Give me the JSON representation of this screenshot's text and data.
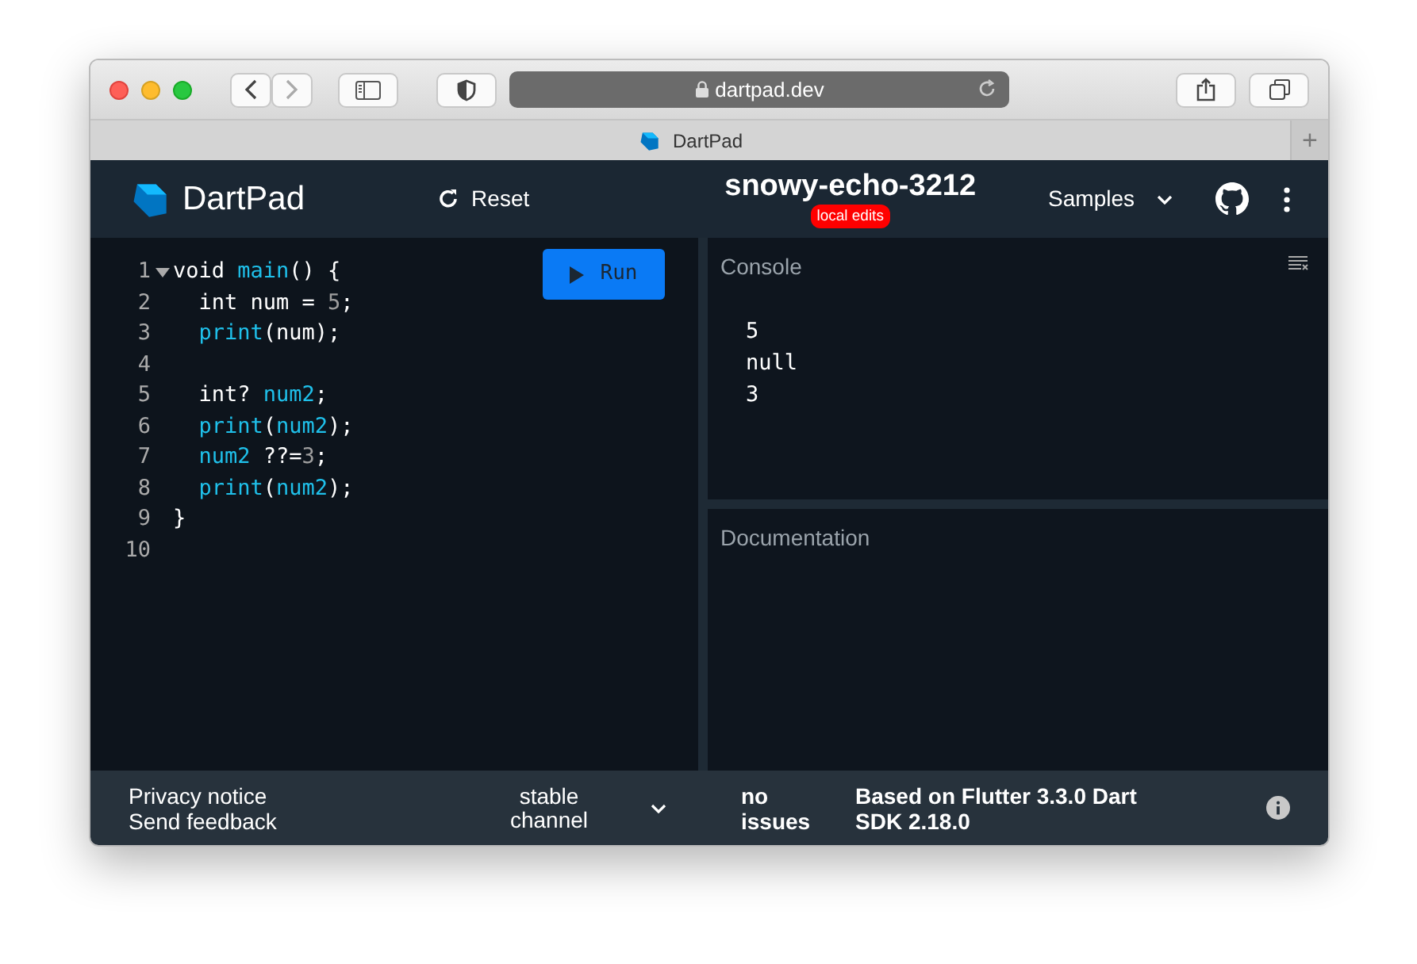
{
  "browser": {
    "address": "dartpad.dev",
    "tab_title": "DartPad",
    "new_tab": "+"
  },
  "app": {
    "logo_text": "DartPad",
    "reset": "Reset",
    "pad_name": "snowy-echo-3212",
    "edit_badge": "local edits",
    "samples": "Samples"
  },
  "editor": {
    "run": "Run",
    "lines": [
      {
        "number": "1",
        "folded": false,
        "tokens": [
          {
            "text": "void ",
            "kind": "plain"
          },
          {
            "text": "main",
            "kind": "fn"
          },
          {
            "text": "() {",
            "kind": "plain"
          }
        ]
      },
      {
        "number": "2",
        "indented": true,
        "tokens": [
          {
            "text": "int num = ",
            "kind": "plain"
          },
          {
            "text": "5",
            "kind": "num"
          },
          {
            "text": ";",
            "kind": "plain"
          }
        ]
      },
      {
        "number": "3",
        "indented": true,
        "tokens": [
          {
            "text": "print",
            "kind": "fn"
          },
          {
            "text": "(num);",
            "kind": "plain"
          }
        ]
      },
      {
        "number": "4"
      },
      {
        "number": "5",
        "indented": true,
        "tokens": [
          {
            "text": "int? ",
            "kind": "plain"
          },
          {
            "text": "num2",
            "kind": "fn"
          },
          {
            "text": ";",
            "kind": "plain"
          }
        ]
      },
      {
        "number": "6",
        "indented": true,
        "tokens": [
          {
            "text": "print",
            "kind": "fn"
          },
          {
            "text": "(",
            "kind": "plain"
          },
          {
            "text": "num2",
            "kind": "fn"
          },
          {
            "text": ");",
            "kind": "plain"
          }
        ]
      },
      {
        "number": "7",
        "indented": true,
        "tokens": [
          {
            "text": "num2",
            "kind": "fn"
          },
          {
            "text": " ??=",
            "kind": "plain"
          },
          {
            "text": "3",
            "kind": "num"
          },
          {
            "text": ";",
            "kind": "plain"
          }
        ]
      },
      {
        "number": "8",
        "indented": true,
        "tokens": [
          {
            "text": "print",
            "kind": "fn"
          },
          {
            "text": "(",
            "kind": "plain"
          },
          {
            "text": "num2",
            "kind": "fn"
          },
          {
            "text": ");",
            "kind": "plain"
          }
        ]
      },
      {
        "number": "9",
        "tokens": [
          {
            "text": "}",
            "kind": "plain"
          }
        ]
      },
      {
        "number": "10"
      }
    ]
  },
  "console": {
    "title": "Console",
    "output": [
      "5",
      "null",
      "3"
    ]
  },
  "documentation": {
    "title": "Documentation"
  },
  "footer": {
    "links": [
      "Privacy notice",
      "Send feedback"
    ],
    "channel": "stable channel",
    "issues": "no issues",
    "version": "Based on Flutter 3.3.0 Dart SDK 2.18.0"
  }
}
